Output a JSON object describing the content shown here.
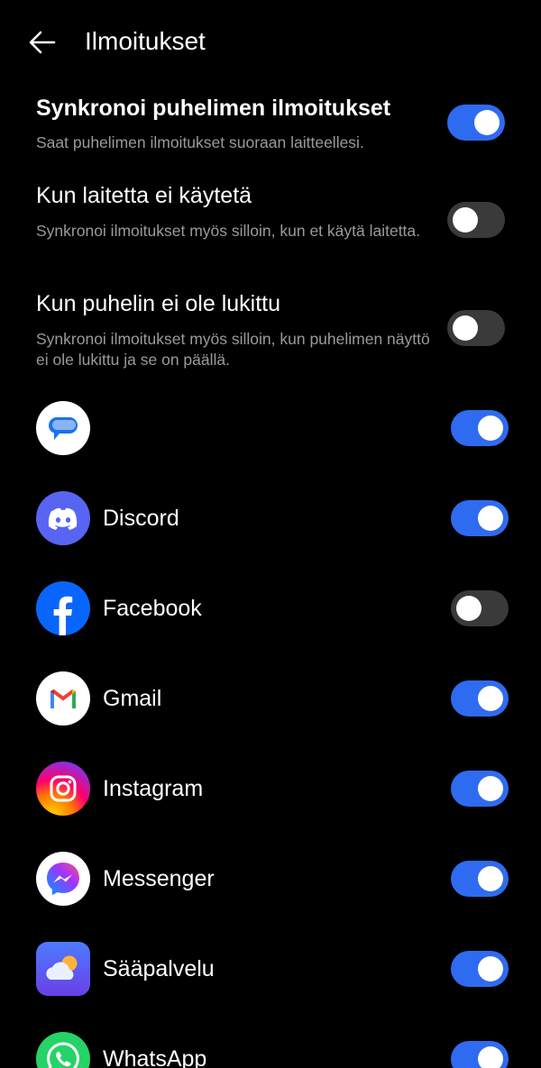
{
  "header": {
    "title": "Ilmoitukset"
  },
  "settings": [
    {
      "title": "Synkronoi puhelimen ilmoitukset",
      "desc": "Saat puhelimen ilmoitukset suoraan laitteellesi.",
      "on": true
    },
    {
      "title": "Kun laitetta ei käytetä",
      "desc": "Synkronoi ilmoitukset myös silloin, kun et käytä laitetta.",
      "on": false
    },
    {
      "title": "Kun puhelin ei ole lukittu",
      "desc": "Synkronoi ilmoitukset myös silloin, kun puhelimen näyttö ei ole lukittu ja se on päällä.",
      "on": false
    }
  ],
  "apps": [
    {
      "name": "",
      "icon": "messages-icon",
      "on": true
    },
    {
      "name": "Discord",
      "icon": "discord-icon",
      "on": true
    },
    {
      "name": "Facebook",
      "icon": "facebook-icon",
      "on": false
    },
    {
      "name": "Gmail",
      "icon": "gmail-icon",
      "on": true
    },
    {
      "name": "Instagram",
      "icon": "instagram-icon",
      "on": true
    },
    {
      "name": "Messenger",
      "icon": "messenger-icon",
      "on": true
    },
    {
      "name": "Sääpalvelu",
      "icon": "weather-icon",
      "on": true
    },
    {
      "name": "WhatsApp",
      "icon": "whatsapp-icon",
      "on": true
    }
  ],
  "colors": {
    "background": "#000000",
    "toggle_on": "#2f6bf0",
    "toggle_off": "#3a3a3a",
    "secondary_text": "#9a9a9a"
  }
}
